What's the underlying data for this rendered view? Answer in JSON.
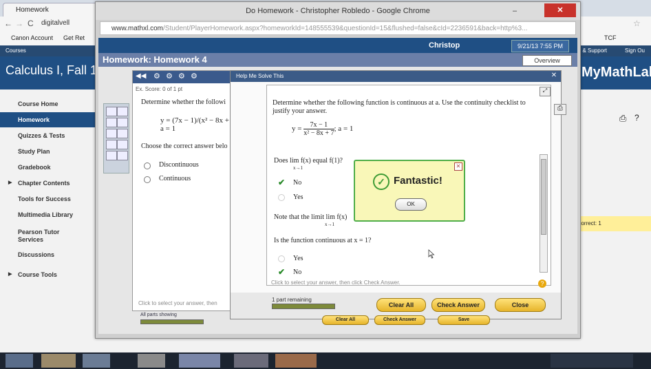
{
  "background_browser": {
    "tab_title": "Homework",
    "address": "digitalvell",
    "bookmarks": [
      "Canon Account",
      "Get Ret",
      "TCF"
    ],
    "courses_label": "Courses",
    "right_links": [
      "lp & Support",
      "Sign Ou"
    ],
    "course_title": "Calculus I, Fall 1",
    "mml_logo": "MyMathLab",
    "nav_items": [
      {
        "label": "Course Home",
        "active": false,
        "arrow": false
      },
      {
        "label": "Homework",
        "active": true,
        "arrow": false
      },
      {
        "label": "Quizzes & Tests",
        "active": false,
        "arrow": false
      },
      {
        "label": "Study Plan",
        "active": false,
        "arrow": false
      },
      {
        "label": "Gradebook",
        "active": false,
        "arrow": false
      },
      {
        "label": "Chapter Contents",
        "active": false,
        "arrow": true
      },
      {
        "label": "Tools for Success",
        "active": false,
        "arrow": false
      },
      {
        "label": "Multimedia Library",
        "active": false,
        "arrow": false
      },
      {
        "label": "Pearson Tutor Services",
        "active": false,
        "arrow": false
      },
      {
        "label": "Discussions",
        "active": false,
        "arrow": false
      },
      {
        "label": "Course Tools",
        "active": false,
        "arrow": true
      }
    ],
    "incorrect_label": "ncorrect: 1"
  },
  "popup": {
    "window_title": "Do Homework - Christopher Robledo - Google Chrome",
    "url_host": "www.mathxl.com",
    "url_path": "/Student/PlayerHomework.aspx?homeworkId=148555539&questionId=15&flushed=false&cId=2236591&back=http%3...",
    "user_name": "Christop",
    "date_time": "9/21/13 7:55 PM",
    "homework_prefix": "Homework:",
    "homework_title": "Homework 4",
    "overview_label": "Overview"
  },
  "exercise": {
    "score": "Ex. Score: 0 of 1 pt",
    "question": "Determine whether the followi",
    "equation": "y = (7x − 1)/(x² − 8x + 7); a = 1",
    "choose": "Choose the correct answer belo",
    "options": [
      "Discontinuous",
      "Continuous"
    ],
    "footer": "Click to select your answer, then",
    "parts_label": "All parts showing"
  },
  "help": {
    "header": "Help Me Solve This",
    "question": "Determine whether the following function is continuous at a. Use the continuity checklist to justify your answer.",
    "equation_lhs": "y =",
    "equation_num": "7x − 1",
    "equation_den": "x² − 8x + 7",
    "equation_a": "; a = 1",
    "q1": "Does lim f(x) equal f(1)?",
    "q1_sub": "x→1",
    "q1_answers": [
      {
        "label": "No",
        "checked": true
      },
      {
        "label": "Yes",
        "checked": false
      }
    ],
    "note": "Note that the limit  lim f(x)",
    "note_sub": "x→1",
    "q2": "Is the function continuous at x = 1?",
    "q2_answers": [
      {
        "label": "Yes",
        "checked": false
      },
      {
        "label": "No",
        "checked": true
      }
    ],
    "footer": "Click to select your answer, then click Check Answer.",
    "part_remaining": "1 part remaining",
    "buttons": {
      "clear_all": "Clear All",
      "check_answer": "Check Answer",
      "close": "Close"
    }
  },
  "dialog": {
    "message": "Fantastic!",
    "ok_label": "OK"
  },
  "under_buttons": [
    "Clear All",
    "Check Answer",
    "Save"
  ]
}
